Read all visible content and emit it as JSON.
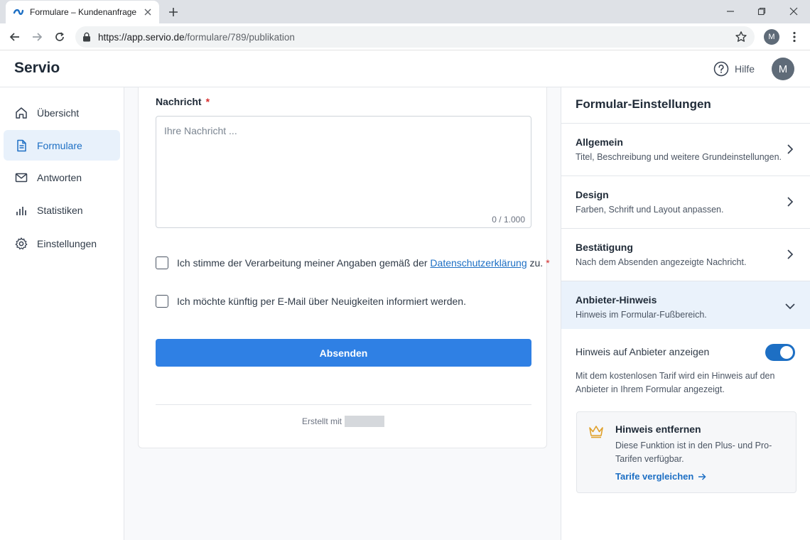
{
  "browser": {
    "tab_title": "Formulare – Kundenanfrage",
    "url_host": "https://app.servio.de",
    "url_path": "/formulare/789/publikation",
    "profile_initial": "M"
  },
  "header": {
    "brand": "Servio",
    "help_label": "Hilfe",
    "avatar_initial": "M"
  },
  "sidebar": {
    "items": [
      {
        "label": "Übersicht",
        "icon": "home-icon"
      },
      {
        "label": "Formulare",
        "icon": "document-icon",
        "active": true
      },
      {
        "label": "Antworten",
        "icon": "mail-icon"
      },
      {
        "label": "Statistiken",
        "icon": "bar-chart-icon"
      },
      {
        "label": "Einstellungen",
        "icon": "gear-icon"
      }
    ]
  },
  "form": {
    "message_label": "Nachricht",
    "required_mark": "*",
    "message_placeholder": "Ihre Nachricht ...",
    "char_counter": "0 / 1.000",
    "consent_prefix": "Ich stimme der Verarbeitung meiner Angaben gemäß der",
    "consent_link": "Datenschutzerklärung",
    "consent_suffix": "zu.",
    "newsletter_label": "Ich möchte künftig per E-Mail über Neuigkeiten informiert werden.",
    "submit_label": "Absenden",
    "footer_made_with": "Erstellt mit"
  },
  "panel": {
    "title": "Formular-Einstellungen",
    "sections": [
      {
        "title": "Allgemein",
        "desc": "Titel, Beschreibung und weitere Grundeinstellungen."
      },
      {
        "title": "Design",
        "desc": "Farben, Schrift und Layout anpassen."
      },
      {
        "title": "Bestätigung",
        "desc": "Nach dem Absenden angezeigte Nachricht."
      },
      {
        "title": "Anbieter-Hinweis",
        "desc": "Hinweis im Formular-Fußbereich.",
        "expanded": true
      }
    ],
    "toggle_label": "Hinweis auf Anbieter anzeigen",
    "toggle_on": true,
    "info_text": "Mit dem kostenlosen Tarif wird ein Hinweis auf den Anbieter in Ihrem Formular angezeigt.",
    "upgrade": {
      "title": "Hinweis entfernen",
      "desc": "Diese Funktion ist in den Plus- und Pro-Tarifen verfügbar.",
      "link": "Tarife vergleichen"
    }
  },
  "colors": {
    "accent": "#1d6fc4",
    "button": "#2f80e4",
    "active_bg": "#e8f1fb",
    "required": "#d62d2d",
    "crown": "#e0a02a"
  }
}
